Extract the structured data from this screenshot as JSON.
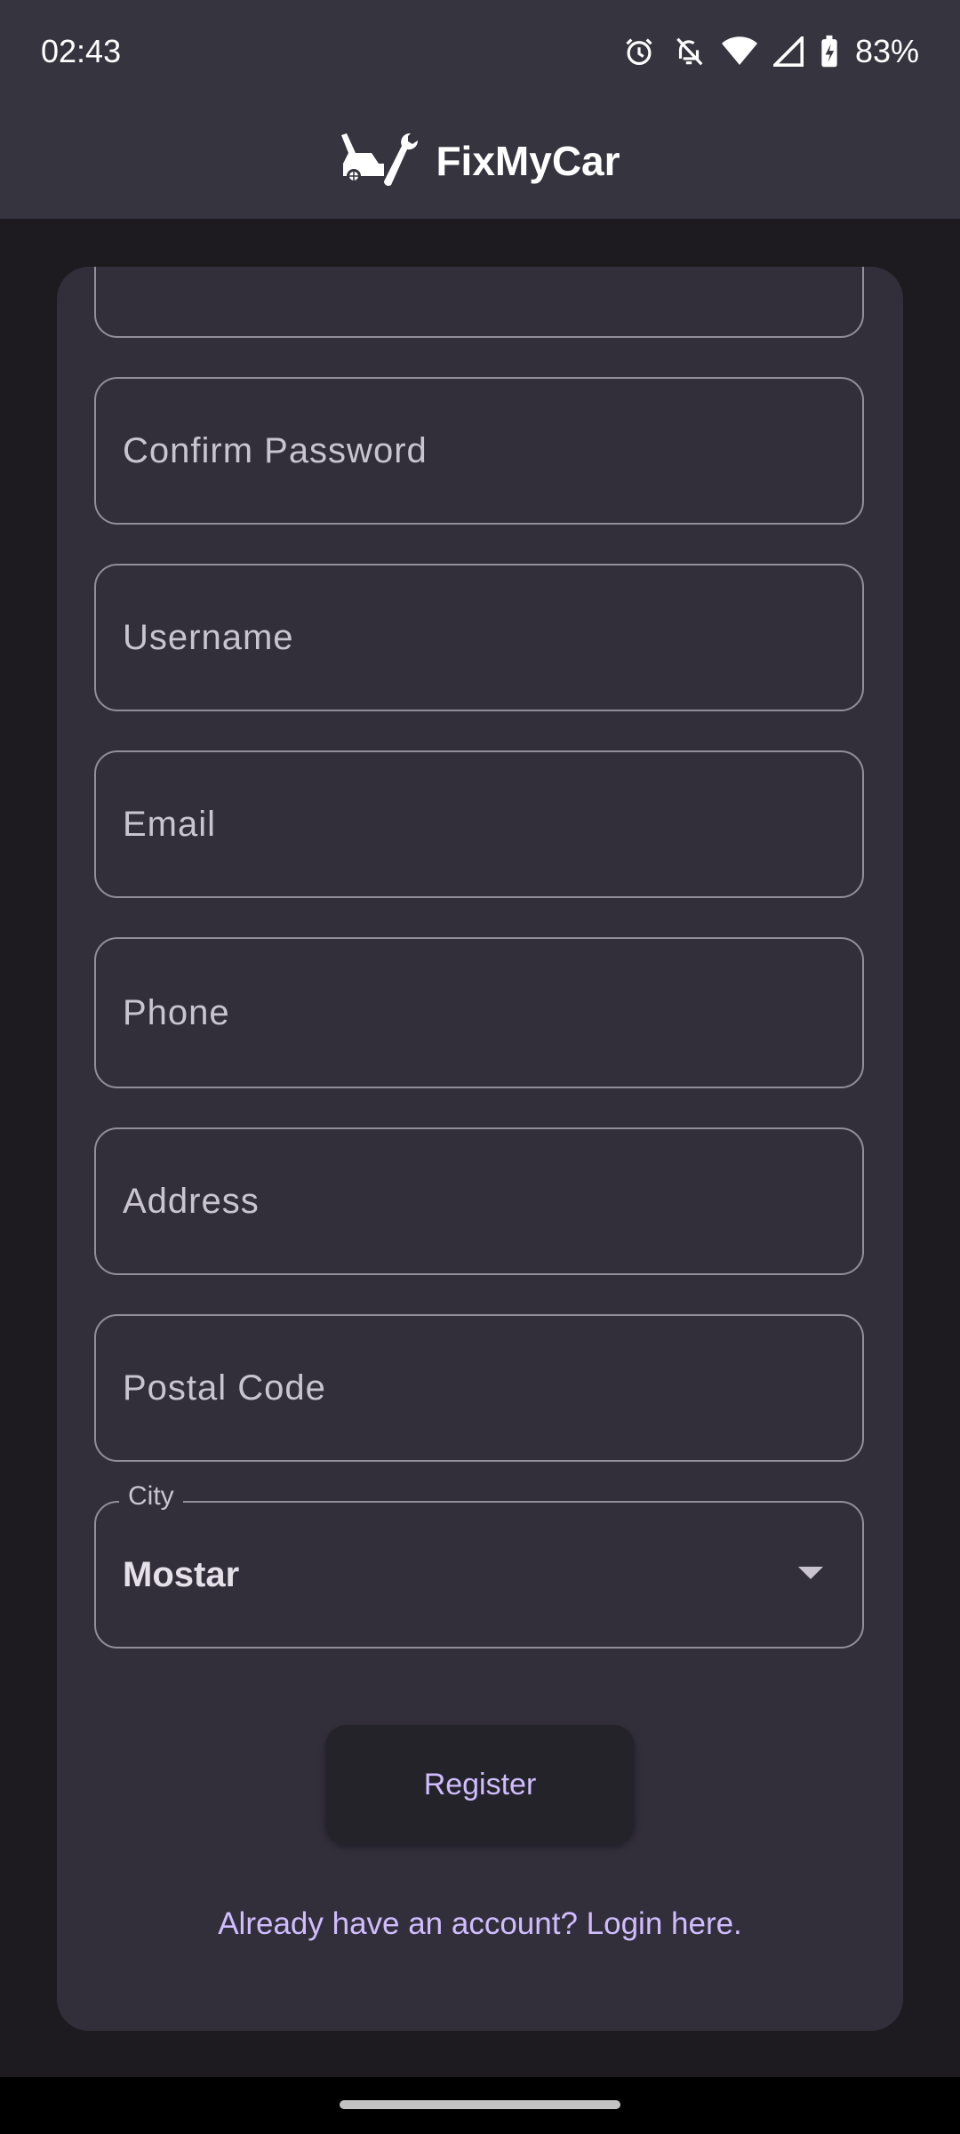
{
  "status_bar": {
    "time": "02:43",
    "battery": "83%",
    "icons": [
      "alarm-icon",
      "notifications-off-icon",
      "wifi-icon",
      "cellular-signal-icon",
      "battery-charging-icon"
    ]
  },
  "app_bar": {
    "title": "FixMyCar",
    "logo_icon": "car-wrench-logo-icon"
  },
  "form": {
    "confirm_password": {
      "placeholder": "Confirm Password",
      "value": ""
    },
    "username": {
      "placeholder": "Username",
      "value": ""
    },
    "email": {
      "placeholder": "Email",
      "value": ""
    },
    "phone": {
      "placeholder": "Phone",
      "value": ""
    },
    "address": {
      "placeholder": "Address",
      "value": ""
    },
    "postal_code": {
      "placeholder": "Postal Code",
      "value": ""
    },
    "city": {
      "label": "City",
      "selected": "Mostar"
    }
  },
  "actions": {
    "register_label": "Register",
    "login_link": "Already have an account? Login here."
  },
  "colors": {
    "accent": "#d0bcff",
    "surface": "#322f3b",
    "background": "#1d1b20",
    "outline": "#938f99"
  }
}
